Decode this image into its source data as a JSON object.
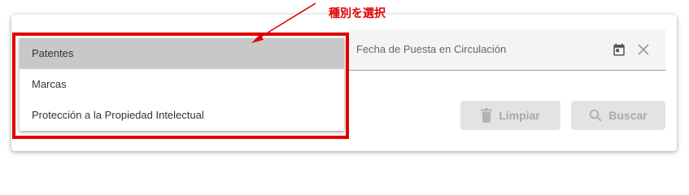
{
  "annotation": {
    "text": "種別を選択",
    "color": "#e00000"
  },
  "type_dropdown": {
    "options": [
      {
        "label": "Patentes",
        "selected": true
      },
      {
        "label": "Marcas",
        "selected": false
      },
      {
        "label": "Protección a la Propiedad Intelectual",
        "selected": false
      }
    ]
  },
  "date_field": {
    "label": "Fecha de Puesta en Circulación",
    "icons": [
      "calendar-icon",
      "close-icon"
    ]
  },
  "buttons": {
    "clear_label": "Limpiar",
    "clear_icon": "trash-icon",
    "search_label": "Buscar",
    "search_icon": "search-icon",
    "disabled": true
  }
}
